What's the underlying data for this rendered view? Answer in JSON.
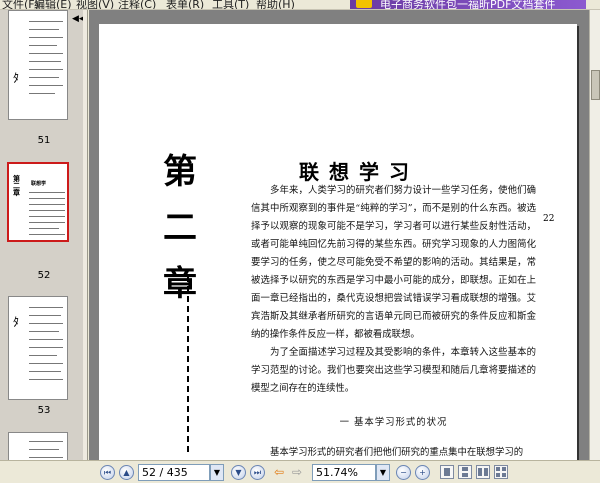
{
  "menu": [
    {
      "label": "文件(F)"
    },
    {
      "label": "编辑(E)"
    },
    {
      "label": "视图(V)"
    },
    {
      "label": "注释(C)"
    },
    {
      "label": "表单(R)"
    },
    {
      "label": "工具(T)"
    },
    {
      "label": "帮助(H)"
    }
  ],
  "banner": {
    "text": "电子商务软件包一福昕PDF文档套件",
    "logo_color": "#f2c200"
  },
  "thumbnails": {
    "collapse_icon": "double-left-chevron",
    "items": [
      {
        "page_label": "51",
        "selected": false
      },
      {
        "page_label": "52",
        "selected": true,
        "mini_heading": "联想学",
        "mini_chapter": "第二章"
      },
      {
        "page_label": "53",
        "selected": false
      }
    ]
  },
  "document": {
    "chapter_heading": [
      "第",
      "二",
      "章"
    ],
    "title": "联想学习",
    "margin_number": "22",
    "paragraphs": [
      "多年来，人类学习的研究者们努力设计一些学习任务，使他们确信其中所观察到的事件是“纯粹的学习”，而不是别的什么东西。被选择予以观察的现象可能不是学习，学习者可以进行某些反射性活动，或者可能单纯回忆先前习得的某些东西。研究学习现象的人力图简化要学习的任务，使之尽可能免受不希望的影响的活动。其结果是，常被选择予以研究的东西是学习中最小可能的成分，即联想。正如在上面一章已经指出的，桑代克设想把尝试错误学习看成联想的增强。艾宾浩斯及其继承者所研究的言语单元同已而被研究的条件反应和斯金纳的操作条件反应一样，都被看成联想。",
      "为了全面描述学习过程及其受影响的条件，本章转入这些基本的学习范型的讨论。我们也要突出这些学习模型和随后几章将要描述的模型之间存在的连续性。"
    ],
    "section_heading": "一  基本学习形式的状况",
    "last_paragraph": "基本学习形式的研究者们把他们研究的重点集中在联想学习的"
  },
  "statusbar": {
    "first_icon": "first-page-icon",
    "prev_icon": "previous-page-icon",
    "page_value": "52 / 435",
    "next_icon": "next-page-icon",
    "last_icon": "last-page-icon",
    "back_icon": "back-arrow-icon",
    "forward_icon": "forward-arrow-icon",
    "zoom_out_icon": "zoom-out-icon",
    "zoom_in_icon": "zoom-in-icon",
    "zoom_value": "51.74%",
    "layouts": [
      "single-page-icon",
      "continuous-icon",
      "facing-icon",
      "continuous-facing-icon"
    ]
  },
  "colors": {
    "doc_background": "#808080",
    "selected_thumb_border": "#cc1a1a",
    "accent_arrow": "#e27b12"
  }
}
